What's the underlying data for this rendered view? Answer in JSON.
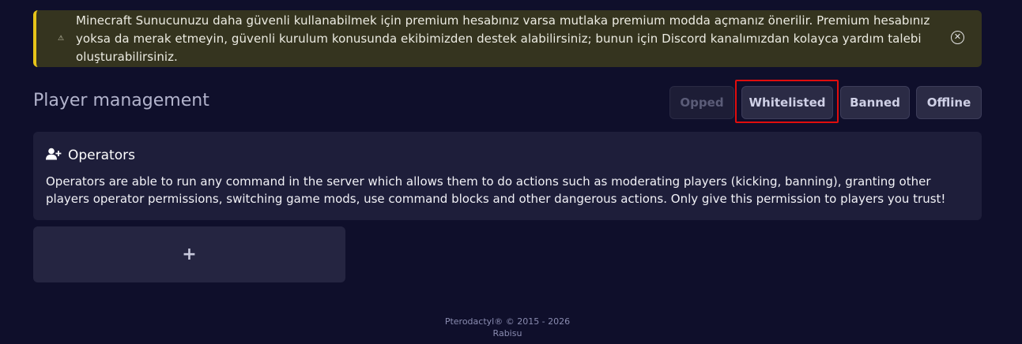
{
  "alert": {
    "icon": "warning-icon",
    "message": "Minecraft Sunucunuzu daha güvenli kullanabilmek için premium hesabınız varsa mutlaka premium modda açmanız önerilir. Premium hesabınız yoksa da merak etmeyin, güvenli kurulum konusunda ekibimizden destek alabilirsiniz; bunun için Discord kanalımızdan kolayca yardım talebi oluşturabilirsiniz.",
    "accent_color": "#e7c419"
  },
  "page": {
    "title": "Player management"
  },
  "tabs": [
    {
      "label": "Opped",
      "state": "disabled"
    },
    {
      "label": "Whitelisted",
      "state": "highlighted"
    },
    {
      "label": "Banned",
      "state": "normal"
    },
    {
      "label": "Offline",
      "state": "normal"
    }
  ],
  "section": {
    "icon": "user-plus-icon",
    "title": "Operators",
    "description": "Operators are able to run any command in the server which allows them to do actions such as moderating players (kicking, banning), granting other players operator permissions, switching game mods, use command blocks and other dangerous actions. Only give this permission to players you trust!"
  },
  "add_button": {
    "label": "+"
  },
  "footer": {
    "copyright": "Pterodactyl® © 2015 - 2026",
    "brand": "Rabisu"
  },
  "colors": {
    "background": "#0f0f2b",
    "highlight": "#e10d0d"
  }
}
